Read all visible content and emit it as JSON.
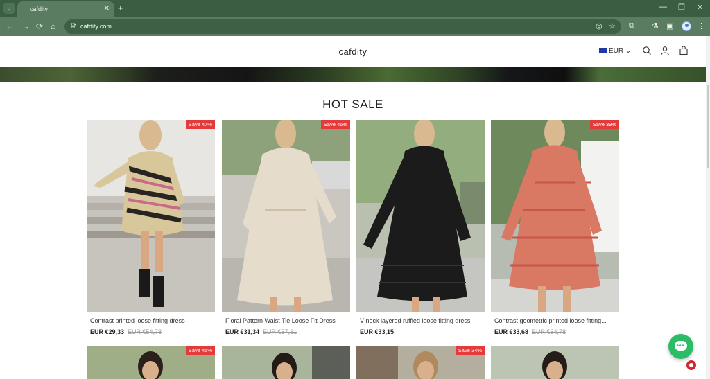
{
  "browser": {
    "tab_title": "cafdity",
    "url": "cafdity.com",
    "new_tab": "+",
    "tab_menu": "⌄",
    "tab_close": "✕",
    "controls": {
      "minimize": "—",
      "restore": "❐",
      "close": "✕"
    },
    "nav": {
      "back": "←",
      "forward": "→",
      "reload": "⟳",
      "home": "⌂"
    }
  },
  "header": {
    "site_title": "cafdity",
    "currency": "EUR"
  },
  "section": {
    "title": "HOT SALE"
  },
  "products": [
    {
      "name": "Contrast printed loose fitting dress",
      "price": "EUR €29,33",
      "old_price": "EUR €54,78",
      "badge": "Save 47%",
      "colors": {
        "bg": "#bfbab2",
        "dress": "#d8c79a",
        "accent": "#2a2420"
      }
    },
    {
      "name": "Floral Pattern Waist Tie Loose Fit Dress",
      "price": "EUR €31,34",
      "old_price": "EUR €57,31",
      "badge": "Save 46%",
      "colors": {
        "bg": "#c9c7c0",
        "dress": "#e6dccb",
        "accent": "#cdbfa7"
      }
    },
    {
      "name": "V-neck layered ruffled loose fitting dress",
      "price": "EUR €33,15",
      "old_price": "",
      "badge": "",
      "colors": {
        "bg": "#b9c0b0",
        "dress": "#1b1b1b",
        "accent": "#333333"
      }
    },
    {
      "name": "Contrast geometric printed loose fitting...",
      "price": "EUR €33,68",
      "old_price": "EUR €54,78",
      "badge": "Save 39%",
      "colors": {
        "bg": "#b7bcb3",
        "dress": "#d97863",
        "accent": "#c6564a"
      }
    }
  ],
  "products_row2": [
    {
      "badge": "Save 45%"
    },
    {
      "badge": ""
    },
    {
      "badge": "Save 34%"
    },
    {
      "badge": ""
    }
  ]
}
